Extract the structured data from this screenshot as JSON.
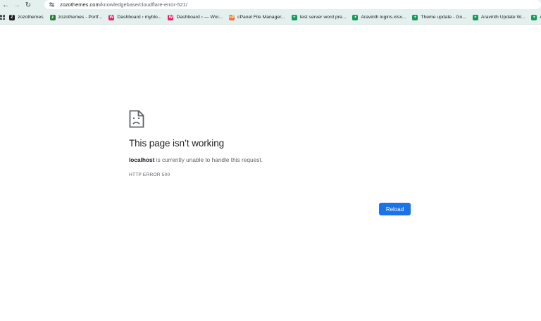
{
  "browser": {
    "url_host": "zozothemes.com",
    "url_path": "/knowledgebase/cloudflare-error-521/"
  },
  "bookmarks": [
    {
      "label": "zozothemes",
      "icon": "zozothemes-favicon",
      "color": "#1a1a1a",
      "glyph": "Z"
    },
    {
      "label": "zozothemes - Portf...",
      "icon": "zozothemes-portfolio-favicon",
      "color": "#2e7d32",
      "glyph": "z"
    },
    {
      "label": "Dashboard ‹ myblo...",
      "icon": "wordpress-pink-favicon",
      "color": "#e91e63",
      "glyph": "W"
    },
    {
      "label": "Dashboard ‹ — Wor...",
      "icon": "wordpress-pink-favicon",
      "color": "#e91e63",
      "glyph": "W"
    },
    {
      "label": "cPanel File Manager...",
      "icon": "cpanel-favicon",
      "color": "#ff6c2c",
      "glyph": "cP"
    },
    {
      "label": "test server word pre...",
      "icon": "google-sheets-favicon",
      "color": "#0f9d58",
      "glyph": "+"
    },
    {
      "label": "Aravinth logins.xlsx...",
      "icon": "google-sheets-favicon",
      "color": "#0f9d58",
      "glyph": "+"
    },
    {
      "label": "Theme update - Go...",
      "icon": "google-sheets-favicon",
      "color": "#0f9d58",
      "glyph": "+"
    },
    {
      "label": "Aravinth Update W...",
      "icon": "google-sheets-favicon",
      "color": "#0f9d58",
      "glyph": "+"
    },
    {
      "label": "All lin",
      "icon": "google-sheets-favicon",
      "color": "#0f9d58",
      "glyph": "+"
    }
  ],
  "error": {
    "title": "This page isn’t working",
    "host": "localhost",
    "message": " is currently unable to handle this request.",
    "code": "HTTP ERROR 500",
    "reload_label": "Reload"
  },
  "colors": {
    "toolbar_bg": "#e3f0ee",
    "button_blue": "#1a73e8"
  }
}
